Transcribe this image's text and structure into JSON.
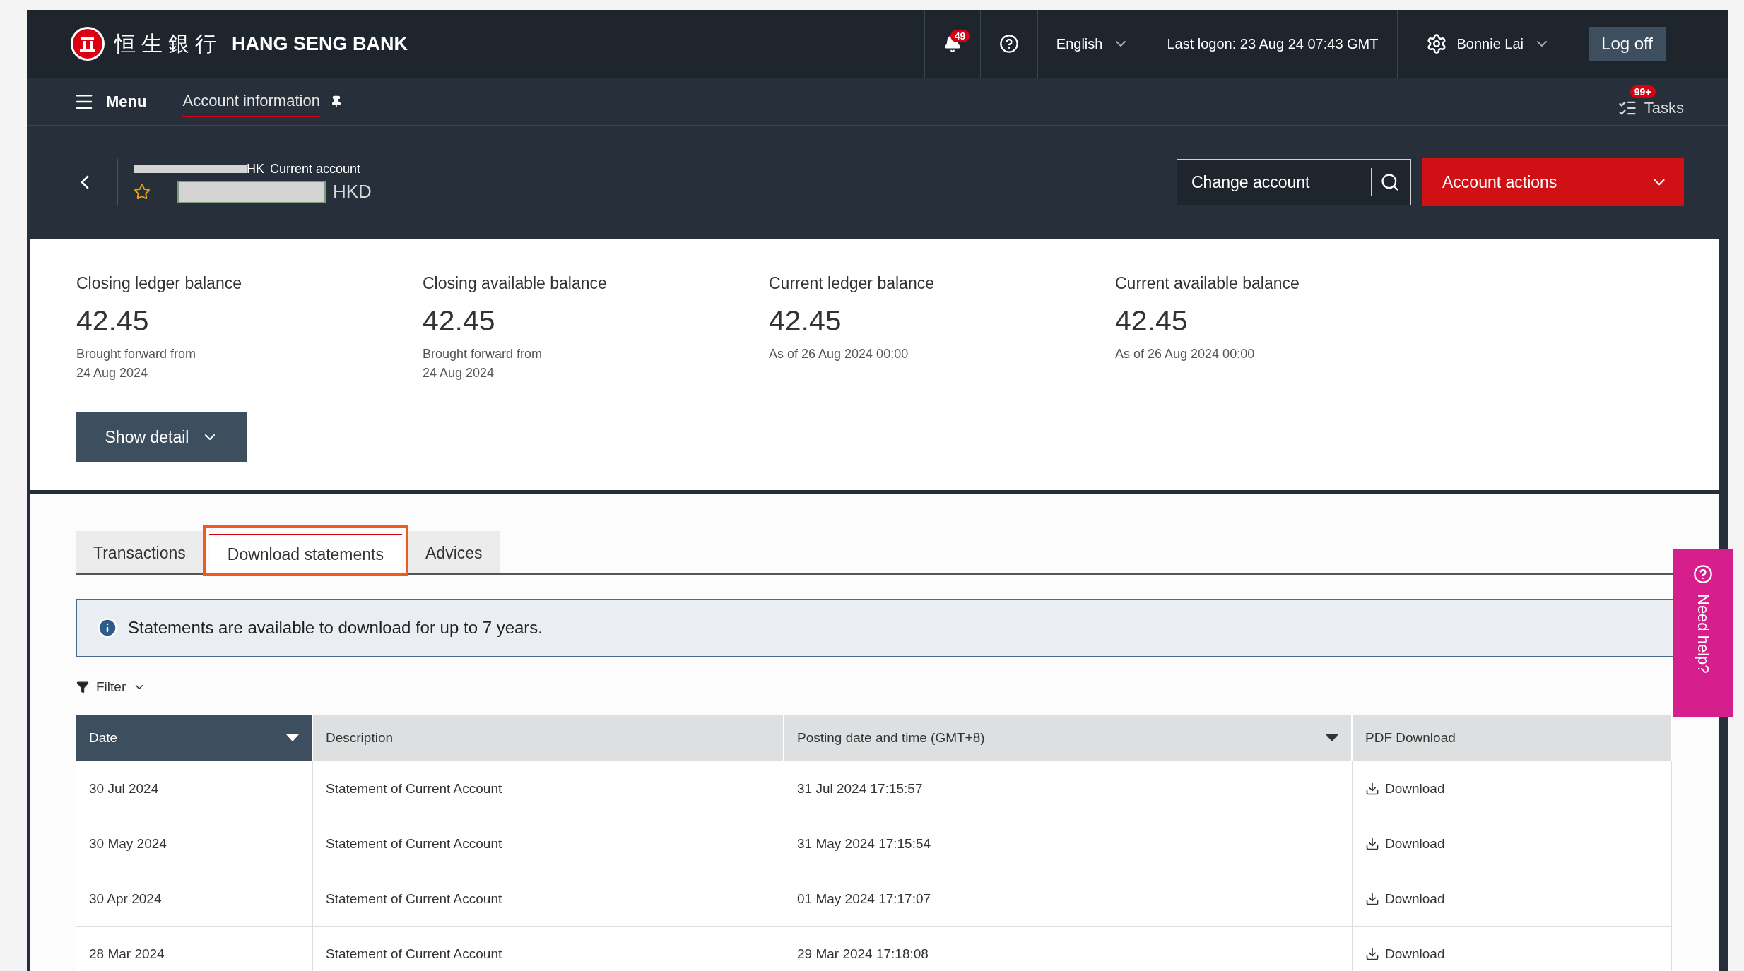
{
  "header": {
    "bank_name_chinese": "恒生銀行",
    "bank_name": "HANG SENG BANK",
    "notifications_count": "49",
    "language": "English",
    "last_logon": "Last logon: 23 Aug 24 07:43 GMT",
    "user_name": "Bonnie Lai",
    "logoff": "Log off"
  },
  "nav": {
    "menu": "Menu",
    "breadcrumb": "Account information",
    "tasks": "Tasks",
    "tasks_count": "99+"
  },
  "account": {
    "name_tail": "HK",
    "type": "Current account",
    "currency": "HKD",
    "favorite": true,
    "change_account_placeholder": "Change account",
    "actions": "Account actions"
  },
  "balances": [
    {
      "label": "Closing ledger balance",
      "amount": "42.45",
      "note": [
        "Brought forward from",
        "24 Aug 2024"
      ]
    },
    {
      "label": "Closing available balance",
      "amount": "42.45",
      "note": [
        "Brought forward from",
        "24 Aug 2024"
      ]
    },
    {
      "label": "Current ledger balance",
      "amount": "42.45",
      "note": [
        "As of 26 Aug 2024 00:00"
      ]
    },
    {
      "label": "Current available balance",
      "amount": "42.45",
      "note": [
        "As of 26 Aug 2024 00:00"
      ]
    }
  ],
  "show_detail": "Show detail",
  "tabs": [
    {
      "label": "Transactions",
      "selected": false,
      "highlighted": false
    },
    {
      "label": "Download statements",
      "selected": true,
      "highlighted": true
    },
    {
      "label": "Advices",
      "selected": false,
      "highlighted": false
    }
  ],
  "info_banner": "Statements are available to download for up to 7 years.",
  "filter": "Filter",
  "table": {
    "columns": [
      {
        "label": "Date",
        "sortable": true,
        "active": true
      },
      {
        "label": "Description",
        "sortable": false,
        "active": false
      },
      {
        "label": "Posting date and time (GMT+8)",
        "sortable": true,
        "active": false
      },
      {
        "label": "PDF Download",
        "sortable": false,
        "active": false
      }
    ],
    "rows": [
      {
        "date": "30 Jul 2024",
        "description": "Statement of Current Account",
        "posted": "31 Jul 2024 17:15:57",
        "download": "Download"
      },
      {
        "date": "30 May 2024",
        "description": "Statement of Current Account",
        "posted": "31 May 2024 17:15:54",
        "download": "Download"
      },
      {
        "date": "30 Apr 2024",
        "description": "Statement of Current Account",
        "posted": "01 May 2024 17:17:07",
        "download": "Download"
      },
      {
        "date": "28 Mar 2024",
        "description": "Statement of Current Account",
        "posted": "29 Mar 2024 17:18:08",
        "download": "Download"
      }
    ]
  },
  "need_help": "Need help?"
}
